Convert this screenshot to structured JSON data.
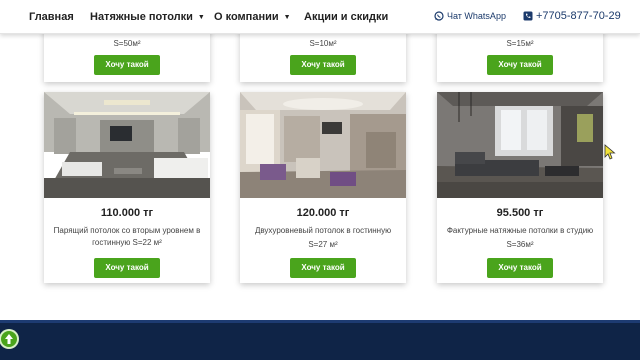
{
  "nav": {
    "home": "Главная",
    "ceilings": "Натяжные потолки",
    "about": "О компании",
    "promo": "Акции и скидки",
    "whatsapp": "Чат WhatsApp",
    "phone": "+7705-877-70-29"
  },
  "top_row": [
    {
      "area": "S=50м²",
      "button": "Хочу такой"
    },
    {
      "area": "S=10м²",
      "button": "Хочу такой"
    },
    {
      "area": "S=15м²",
      "button": "Хочу такой"
    }
  ],
  "cards": [
    {
      "price": "110.000 тг",
      "description": "Парящий потолок со вторым уровнем в гостинную S=22 м²",
      "button": "Хочу такой"
    },
    {
      "price": "120.000 тг",
      "description": "Двухуровневый потолок в гостинную",
      "area": "S=27 м²",
      "button": "Хочу такой"
    },
    {
      "price": "95.500 тг",
      "description": "Фактурные натяжные потолки в студию",
      "area": "S=36м²",
      "button": "Хочу такой"
    }
  ],
  "colors": {
    "accent_green": "#4aa41c",
    "brand_blue": "#1b3a6b",
    "footer": "#0f2447"
  },
  "icons": {
    "whatsapp": "whatsapp-icon",
    "phone": "phone-icon",
    "scroll_up": "arrow-up-icon"
  }
}
